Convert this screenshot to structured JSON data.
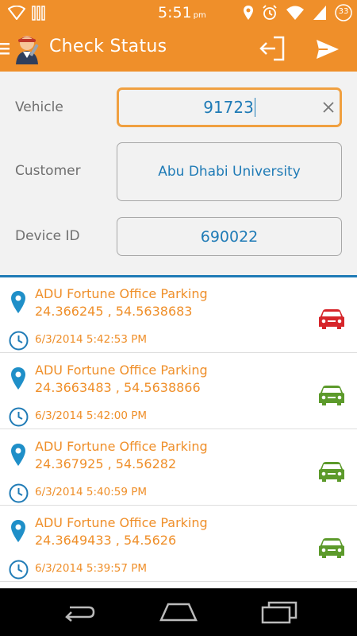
{
  "status_bar": {
    "time": "5:51",
    "ampm": "pm",
    "battery": "33",
    "icons": [
      "wifi-icon",
      "signal-icon",
      "location-icon",
      "alarm-icon",
      "wifi-icon",
      "signal-icon",
      "battery-icon"
    ]
  },
  "app_bar": {
    "title": "Check Status",
    "icons": [
      "menu-icon",
      "app-logo",
      "logout-icon",
      "send-icon"
    ]
  },
  "form": {
    "vehicle": {
      "label": "Vehicle",
      "value": "91723"
    },
    "customer": {
      "label": "Customer",
      "value": "Abu Dhabi University"
    },
    "device": {
      "label": "Device ID",
      "value": "690022"
    }
  },
  "colors": {
    "accent": "#ef8f2a",
    "link_blue": "#1f7bb6",
    "car_red": "#d6262b",
    "car_green": "#5c9a2b"
  },
  "records": [
    {
      "location": "ADU Fortune Office Parking",
      "coords": "24.366245 , 54.5638683",
      "time": "6/3/2014 5:42:53 PM",
      "status_color": "#d6262b"
    },
    {
      "location": "ADU Fortune Office Parking",
      "coords": "24.3663483 , 54.5638866",
      "time": "6/3/2014 5:42:00 PM",
      "status_color": "#5c9a2b"
    },
    {
      "location": "ADU Fortune Office Parking",
      "coords": "24.367925 , 54.56282",
      "time": "6/3/2014 5:40:59 PM",
      "status_color": "#5c9a2b"
    },
    {
      "location": "ADU Fortune Office Parking",
      "coords": "24.3649433 , 54.5626",
      "time": "6/3/2014 5:39:57 PM",
      "status_color": "#5c9a2b"
    }
  ]
}
